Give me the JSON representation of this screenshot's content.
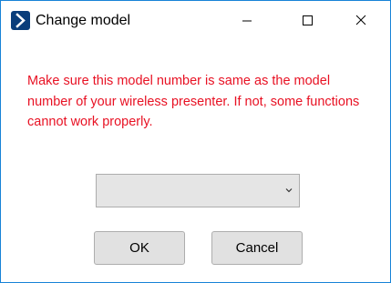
{
  "window": {
    "title": "Change model",
    "controls": {
      "minimize": "minimize-icon",
      "maximize": "maximize-icon",
      "close": "close-icon"
    }
  },
  "dialog": {
    "message": "Make sure this model number is same as the model number of your wireless presenter. If not, some functions cannot work properly.",
    "model_select": {
      "selected": "",
      "icon": "chevron-down-icon"
    },
    "ok_label": "OK",
    "cancel_label": "Cancel"
  },
  "colors": {
    "warning_text": "#e81123",
    "window_border": "#1883d7",
    "app_icon": "#0a3d7a"
  }
}
